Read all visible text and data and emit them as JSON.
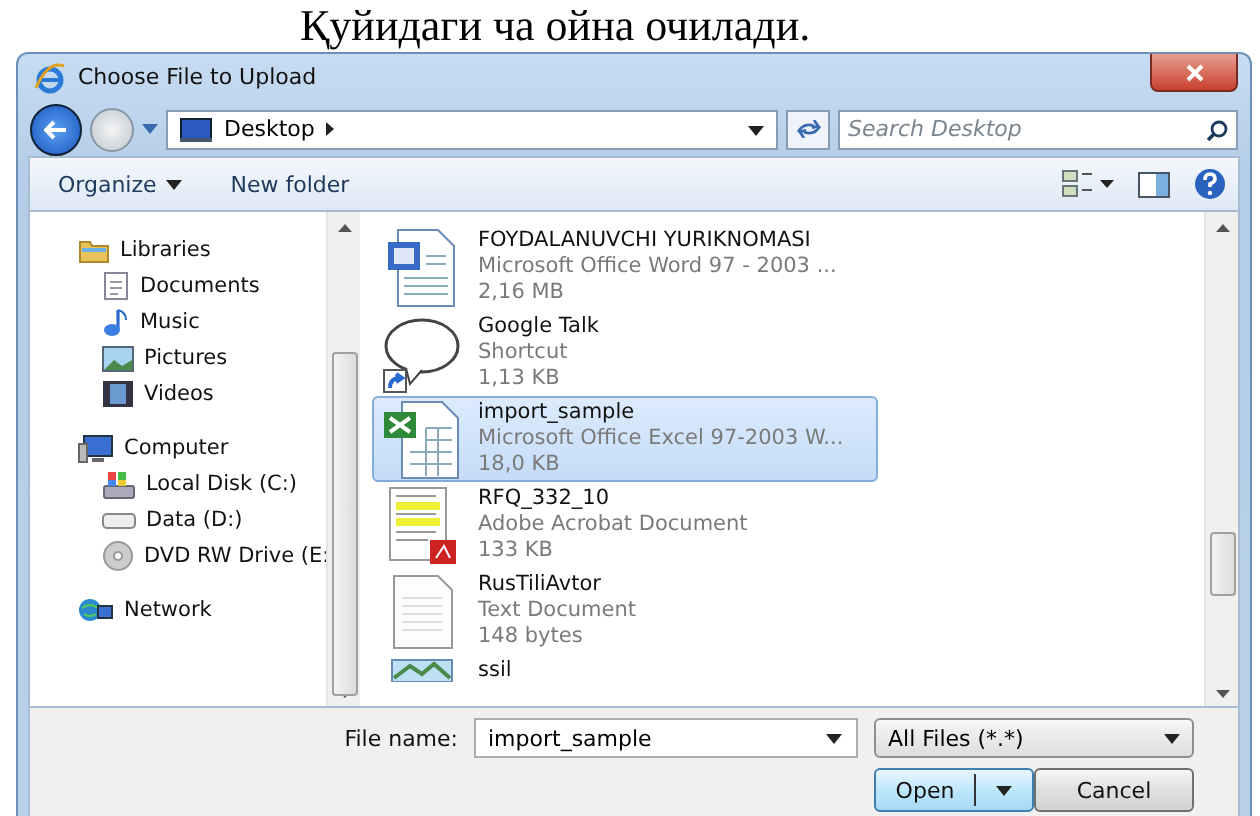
{
  "document_text": "Қуйидаги ча ойна очилади.",
  "window": {
    "title": "Choose File to Upload"
  },
  "address": {
    "path": "Desktop",
    "search_placeholder": "Search Desktop"
  },
  "toolbar": {
    "organize": "Organize",
    "new_folder": "New folder"
  },
  "sidebar": {
    "groups": [
      {
        "label": "Libraries",
        "kind": "library",
        "children": [
          {
            "label": "Documents",
            "kind": "documents"
          },
          {
            "label": "Music",
            "kind": "music"
          },
          {
            "label": "Pictures",
            "kind": "pictures"
          },
          {
            "label": "Videos",
            "kind": "videos"
          }
        ]
      },
      {
        "label": "Computer",
        "kind": "computer",
        "children": [
          {
            "label": "Local Disk (C:)",
            "kind": "disk"
          },
          {
            "label": "Data (D:)",
            "kind": "drive"
          },
          {
            "label": "DVD RW Drive (E:",
            "kind": "dvd"
          }
        ]
      },
      {
        "label": "Network",
        "kind": "network"
      }
    ]
  },
  "files": [
    {
      "name": "FOYDALANUVCHI YURIKNOMASI",
      "type": "Microsoft Office Word 97 - 2003 ...",
      "size": "2,16 MB",
      "kind": "word",
      "selected": false
    },
    {
      "name": "Google Talk",
      "type": "Shortcut",
      "size": "1,13 KB",
      "kind": "talk",
      "selected": false
    },
    {
      "name": "import_sample",
      "type": "Microsoft Office Excel 97-2003 W...",
      "size": "18,0 KB",
      "kind": "excel",
      "selected": true
    },
    {
      "name": "RFQ_332_10",
      "type": "Adobe Acrobat Document",
      "size": "133 KB",
      "kind": "pdf",
      "selected": false
    },
    {
      "name": "RusTiliAvtor",
      "type": "Text Document",
      "size": "148 bytes",
      "kind": "text",
      "selected": false
    },
    {
      "name": "ssil",
      "kind": "image",
      "selected": false
    }
  ],
  "file_name": {
    "label": "File name:",
    "value": "import_sample"
  },
  "filter": "All Files (*.*)",
  "buttons": [
    {
      "label": "Open",
      "kind": "split"
    },
    {
      "label": "Cancel",
      "kind": "plain"
    }
  ]
}
